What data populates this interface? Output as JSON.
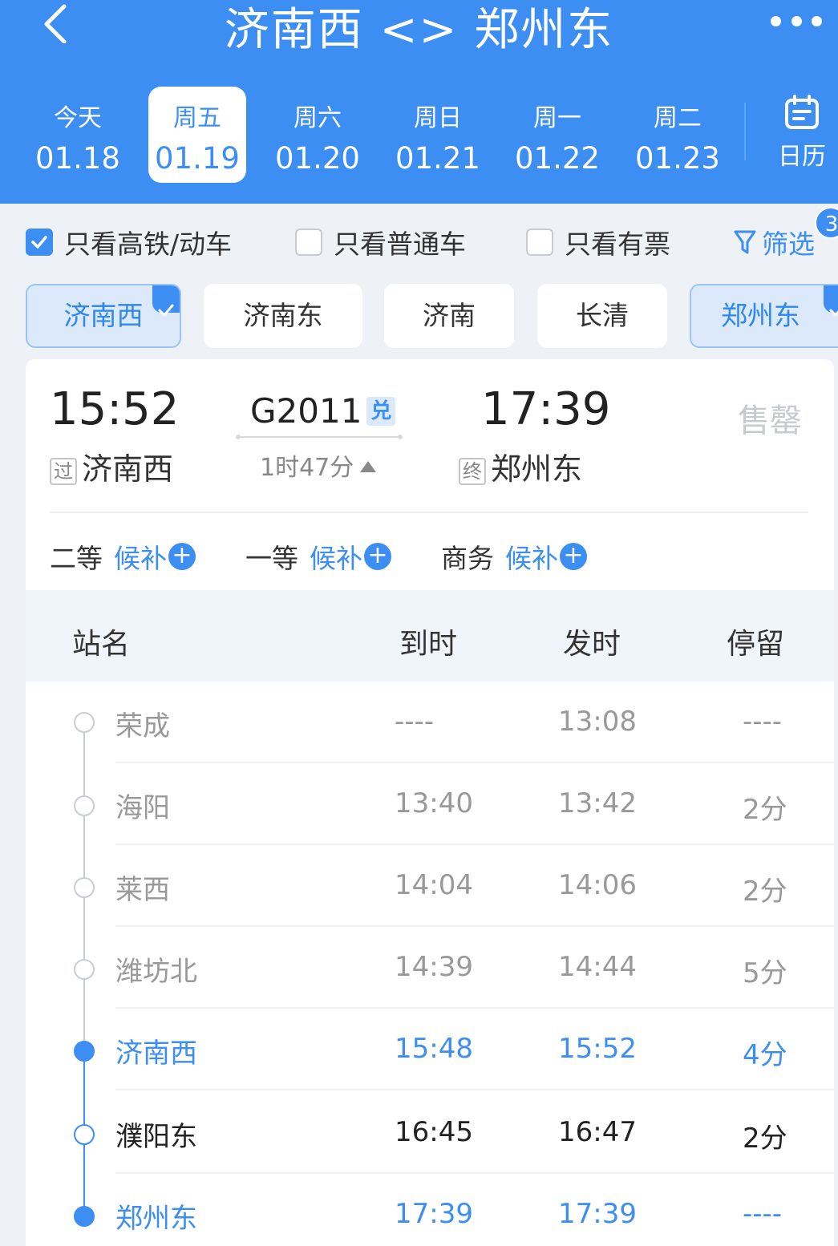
{
  "header": {
    "title": "济南西 <> 郑州东",
    "back_icon": "chevron-left-icon",
    "more_icon": "more-dots-icon"
  },
  "dates": [
    {
      "weekday": "今天",
      "date": "01.18"
    },
    {
      "weekday": "周五",
      "date": "01.19",
      "active": true
    },
    {
      "weekday": "周六",
      "date": "01.20"
    },
    {
      "weekday": "周日",
      "date": "01.21"
    },
    {
      "weekday": "周一",
      "date": "01.22"
    },
    {
      "weekday": "周二",
      "date": "01.23"
    }
  ],
  "calendar": {
    "label": "日历",
    "icon": "calendar-icon"
  },
  "filters": {
    "high_speed": {
      "label": "只看高铁/动车",
      "checked": true
    },
    "normal": {
      "label": "只看普通车",
      "checked": false
    },
    "available": {
      "label": "只看有票",
      "checked": false
    },
    "filter_label": "筛选",
    "filter_count": "3"
  },
  "station_chips": [
    {
      "label": "济南西",
      "selected": true
    },
    {
      "label": "济南东",
      "selected": false
    },
    {
      "label": "济南",
      "selected": false
    },
    {
      "label": "长清",
      "selected": false
    },
    {
      "label": "郑州东",
      "selected": true
    }
  ],
  "train": {
    "depart_time": "15:52",
    "depart_tag": "过",
    "depart_station": "济南西",
    "number": "G2011",
    "exchange_tag": "兑",
    "duration": "1时47分",
    "arrive_time": "17:39",
    "arrive_tag": "终",
    "arrive_station": "郑州东",
    "status": "售罄"
  },
  "seats": [
    {
      "class": "二等",
      "status": "候补"
    },
    {
      "class": "一等",
      "status": "候补"
    },
    {
      "class": "商务",
      "status": "候补"
    }
  ],
  "table": {
    "headers": {
      "station": "站名",
      "arrive": "到时",
      "depart": "发时",
      "stop": "停留"
    },
    "rows": [
      {
        "station": "荣成",
        "arrive": "----",
        "depart": "13:08",
        "stop": "----"
      },
      {
        "station": "海阳",
        "arrive": "13:40",
        "depart": "13:42",
        "stop": "2分"
      },
      {
        "station": "莱西",
        "arrive": "14:04",
        "depart": "14:06",
        "stop": "2分"
      },
      {
        "station": "潍坊北",
        "arrive": "14:39",
        "depart": "14:44",
        "stop": "5分"
      },
      {
        "station": "济南西",
        "arrive": "15:48",
        "depart": "15:52",
        "stop": "4分"
      },
      {
        "station": "濮阳东",
        "arrive": "16:45",
        "depart": "16:47",
        "stop": "2分"
      },
      {
        "station": "郑州东",
        "arrive": "17:39",
        "depart": "17:39",
        "stop": "----"
      }
    ]
  },
  "colors": {
    "accent": "#3d8ef2",
    "muted": "#999999",
    "soldout": "#c6c9cd"
  }
}
